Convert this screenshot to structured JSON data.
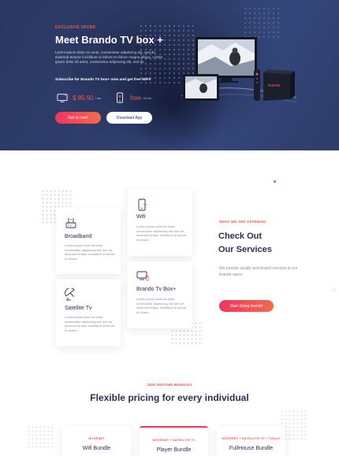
{
  "hero": {
    "eyebrow": "EXCLUSIVE OFFER",
    "title": "Meet Brando TV box +",
    "description": "Lorem ipsum dolor sit amet, consectetur adipiscing elit, sed do eiusmod tempor incididunt ut labore et dolore magna aliqua. Lorem ipsum dolor sit amet, consectetur adipiscing elit, sed do",
    "subscribe": "Subscribe for Brando TV box+ now and get free WiFi!",
    "prices": [
      {
        "value": "$ 85.90",
        "unit": "/ mo"
      },
      {
        "value": "free",
        "unit": "/ 6 mo"
      }
    ],
    "btn_get": "Get in now!",
    "btn_app": "Download App",
    "tv_brand": "brando"
  },
  "services": {
    "eyebrow": "WHAT WE ARE OFFERING",
    "title_line1": "Check Out",
    "title_line2": "Our Services",
    "description": "We provide quality and tested services to our brando users",
    "btn_start": "Start Using brando",
    "cards": [
      {
        "title": "Broadband",
        "text": "Lorem ipsum dolor sit amet, consectetur adipiscing elit, sed do eiusmod tempor incididunt ut labore et dolore."
      },
      {
        "title": "Wifi",
        "text": "Lorem ipsum dolor sit amet, consectetur adipiscing elit, sed do eiusmod tempor incididunt ut labore et dolore."
      },
      {
        "title": "Satellite Tv",
        "text": "Lorem ipsum dolor sit amet, consectetur adipiscing elit, sed do eiusmod tempor incididunt ut labore et dolore."
      },
      {
        "title": "Brando Tv Box+",
        "text": "Lorem ipsum dolor sit amet, consectetur adipiscing elit, sed do eiusmod tempor incididunt ut labore et dolore."
      }
    ]
  },
  "pricing": {
    "eyebrow": "OUR AWSOME BUNDLES",
    "title": "Flexible pricing for every individual",
    "plans": [
      {
        "eyebrow": "INTERNET",
        "name": "Wifi Bundle"
      },
      {
        "eyebrow": "INTERNET + SATELLITE TV",
        "name": "Player Bundle"
      },
      {
        "eyebrow": "INTERNET + SATELLITE TV + TVbox+",
        "name": "FullHouse Bundle"
      }
    ]
  },
  "colors": {
    "accent": "#f4574e",
    "navy": "#2a3054",
    "hero_bg": "#2f3e6d"
  }
}
